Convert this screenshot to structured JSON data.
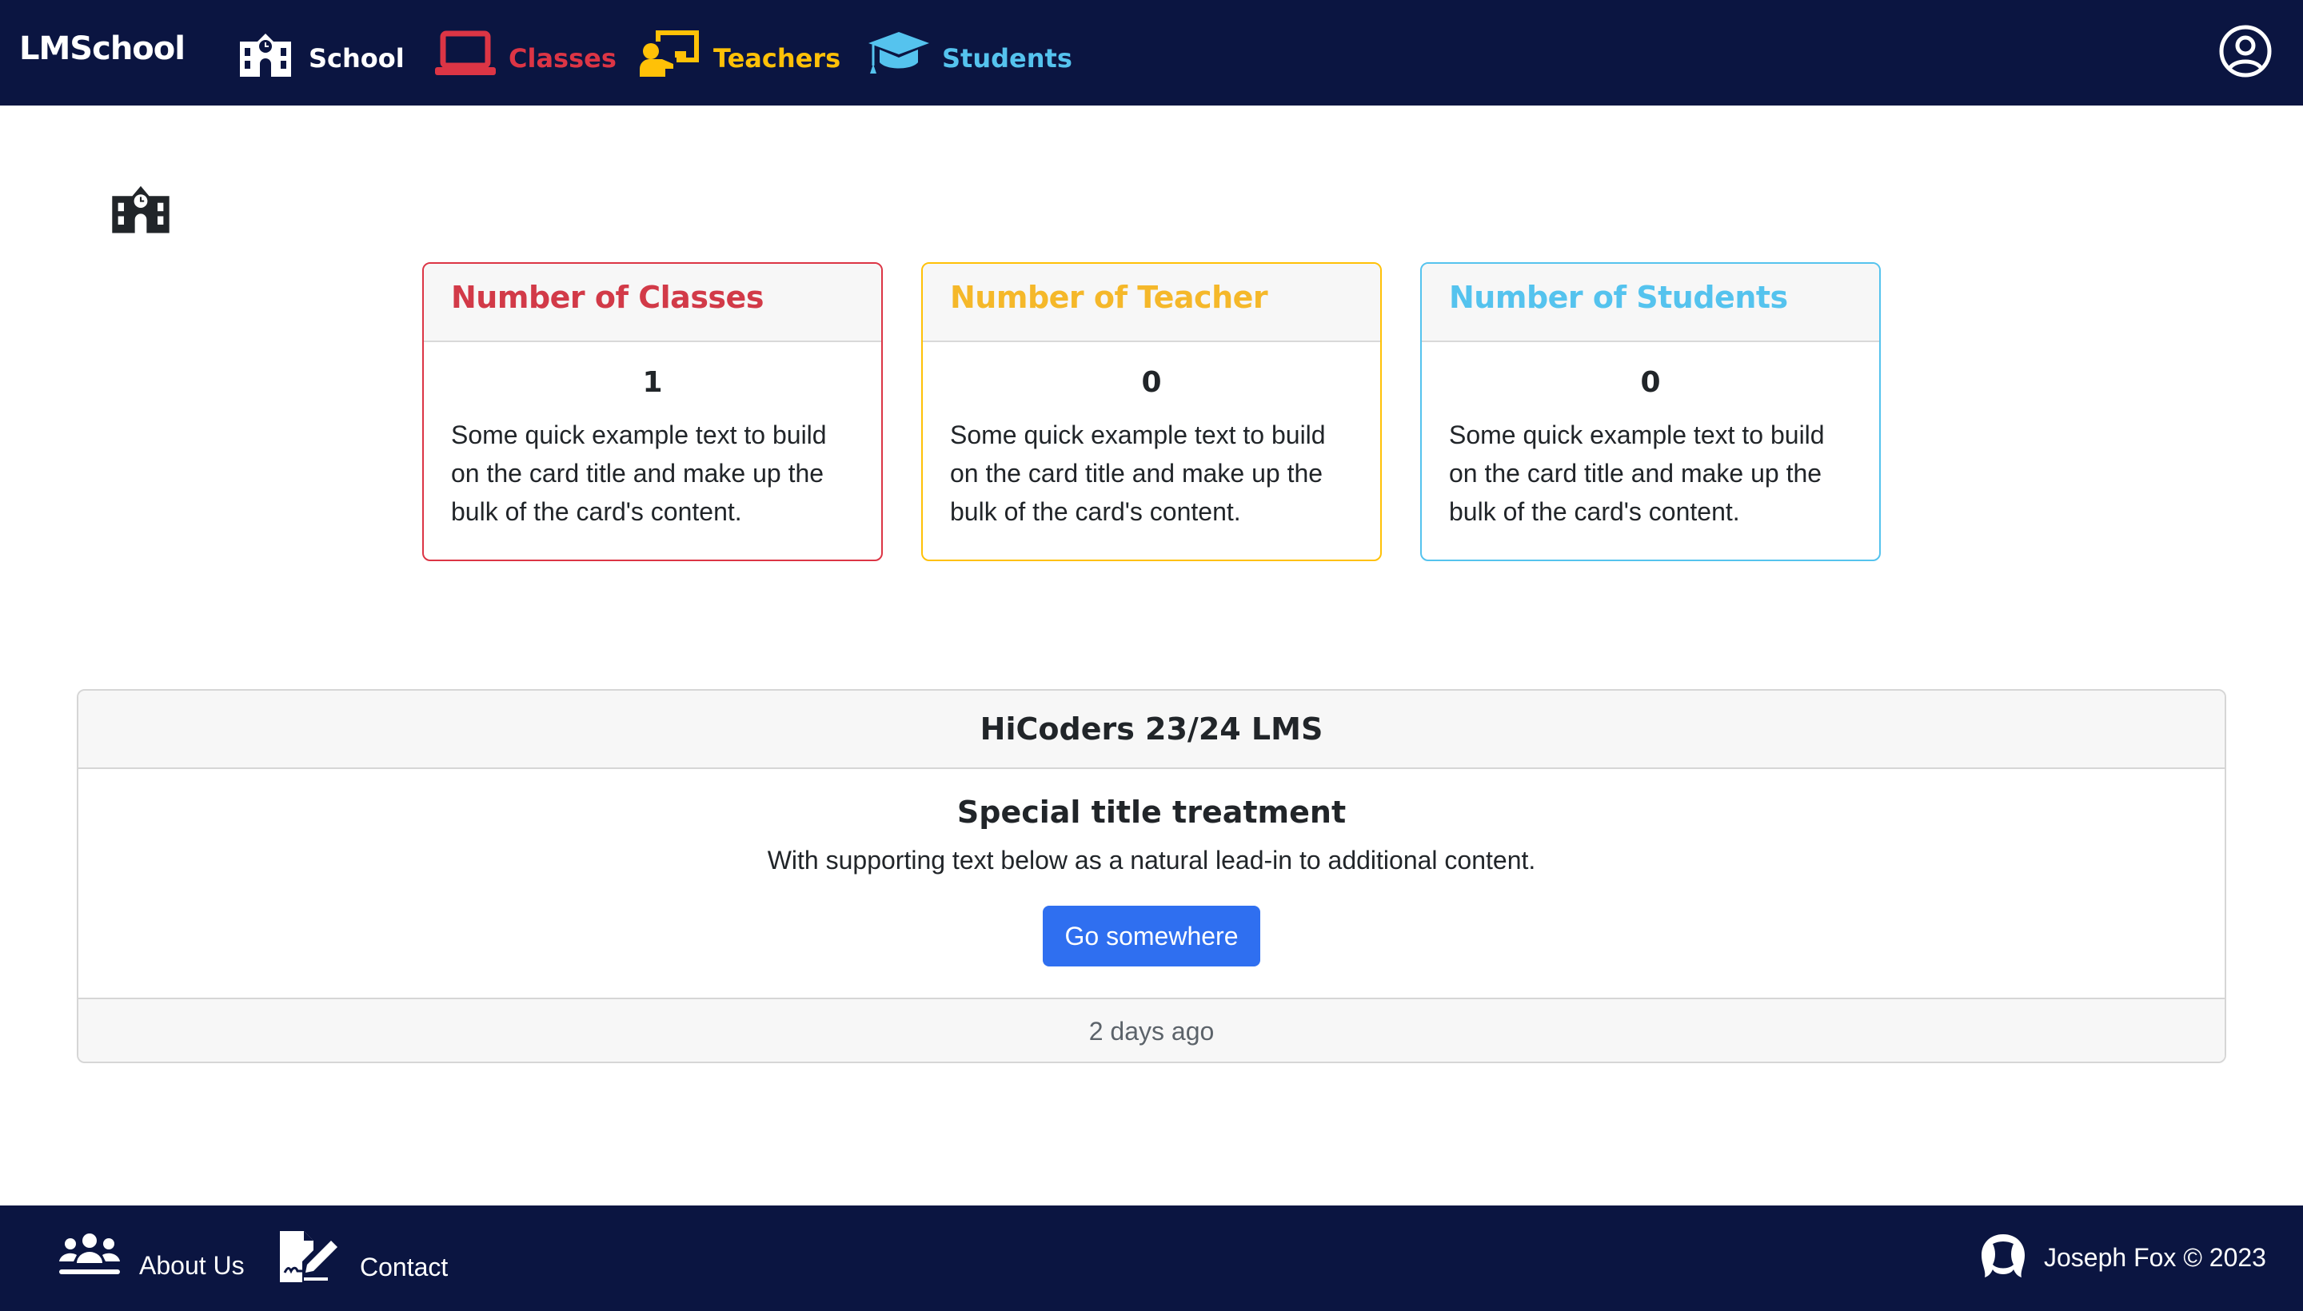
{
  "navbar": {
    "brand": "LMSchool",
    "items": [
      {
        "label": "School",
        "icon": "school-icon",
        "color": "#ffffff"
      },
      {
        "label": "Classes",
        "icon": "laptop-icon",
        "color": "#dc3545"
      },
      {
        "label": "Teachers",
        "icon": "chalkboard-teacher-icon",
        "color": "#ffc107"
      },
      {
        "label": "Students",
        "icon": "graduation-cap-icon",
        "color": "#55c3ee"
      }
    ],
    "account_icon": "user-circle-icon"
  },
  "page_icon": "school-icon",
  "stats": [
    {
      "title": "Number of Classes",
      "count": "1",
      "text": "Some quick example text to build on the card title and make up the bulk of the card's content.",
      "color": "#dc3545"
    },
    {
      "title": "Number of Teacher",
      "count": "0",
      "text": "Some quick example text to build on the card title and make up the bulk of the card's content.",
      "color": "#ffc107"
    },
    {
      "title": "Number of Students",
      "count": "0",
      "text": "Some quick example text to build on the card title and make up the bulk of the card's content.",
      "color": "#55c3ee"
    }
  ],
  "info": {
    "header": "HiCoders 23/24 LMS",
    "title": "Special title treatment",
    "text": "With supporting text below as a natural lead-in to additional content.",
    "button": "Go somewhere",
    "footer": "2 days ago",
    "button_color": "#2f6ff0"
  },
  "footer": {
    "about": "About Us",
    "contact": "Contact",
    "copyright": "Joseph Fox © 2023",
    "background": "#0b1541"
  }
}
